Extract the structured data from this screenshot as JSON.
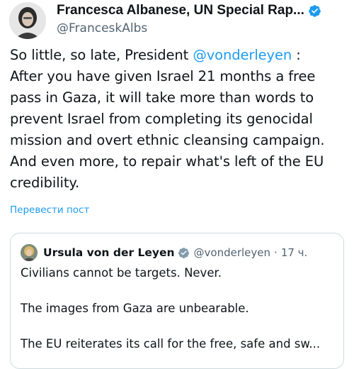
{
  "author": {
    "name": "Francesca Albanese, UN Special Rap...",
    "handle": "@FranceskAlbs",
    "avatar_icon": "profile-photo-icon",
    "verified_icon": "verified-badge-icon"
  },
  "tweet": {
    "text_part1": "So little, so late, President ",
    "mention": "@vonderleyen",
    "text_part2": " :\nAfter you have given Israel 21 months a free pass in Gaza, it will take more than words to prevent Israel from completing its genocidal mission and overt ethnic cleansing campaign. And even more, to repair what's left of the EU credibility."
  },
  "translate_label": "Перевести пост",
  "quote": {
    "name": "Ursula von der Leyen",
    "handle": "@vonderleyen",
    "separator": "·",
    "time": "17 ч.",
    "lines": [
      "Civilians cannot be targets. Never.",
      "The images from Gaza are unbearable.",
      "The EU reiterates its call for the free, safe and sw..."
    ]
  },
  "colors": {
    "accent": "#1d9bf0",
    "text": "#0f1419",
    "secondary": "#536471",
    "border": "#cfd9de"
  }
}
